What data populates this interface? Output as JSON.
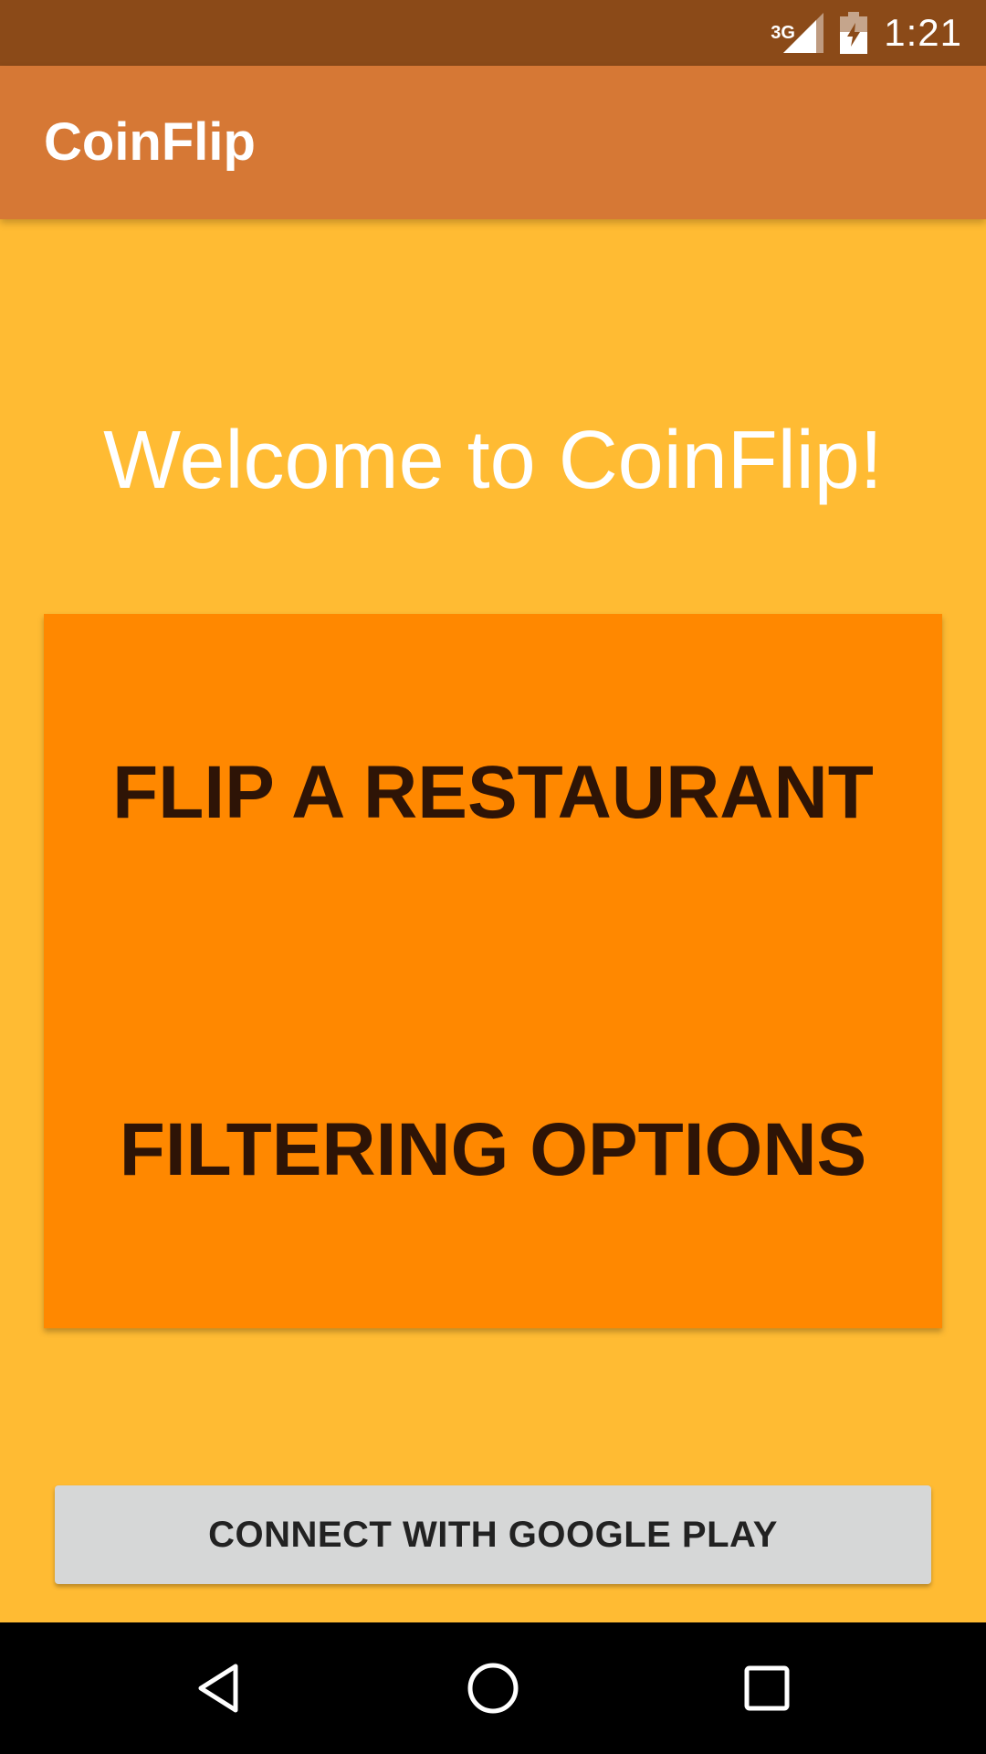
{
  "status_bar": {
    "network_type": "3G",
    "time": "1:21",
    "icons": [
      "signal-icon",
      "battery-charging-icon"
    ]
  },
  "app_bar": {
    "title": "CoinFlip"
  },
  "main": {
    "welcome_text": "Welcome to CoinFlip!",
    "flip_button_label": "FLIP A RESTAURANT",
    "filter_button_label": "FILTERING OPTIONS",
    "google_play_button_label": "CONNECT WITH GOOGLE PLAY"
  },
  "nav_bar": {
    "icons": [
      "back-icon",
      "home-icon",
      "recents-icon"
    ]
  },
  "colors": {
    "status_bar": "#8B4A18",
    "app_bar": "#D67835",
    "background": "#FFBB33",
    "panel": "#FF8800",
    "panel_text": "#2E1406",
    "secondary_button": "#D6D7D7"
  }
}
